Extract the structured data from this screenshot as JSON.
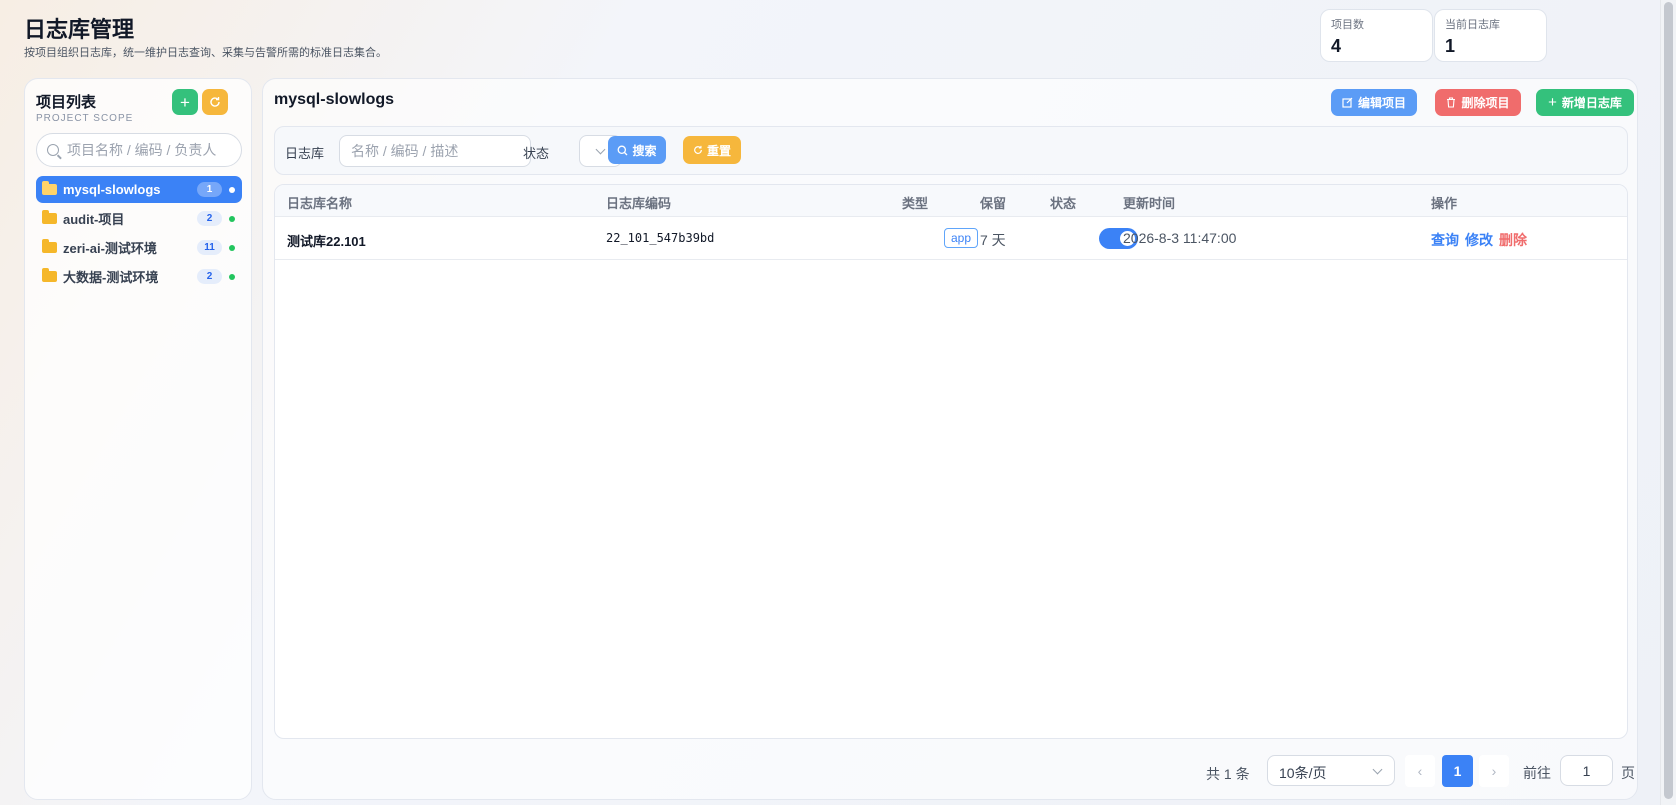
{
  "header": {
    "title": "日志库管理",
    "subtitle": "按项目组织日志库，统一维护日志查询、采集与告警所需的标准日志集合。",
    "stats": [
      {
        "label": "项目数",
        "value": "4"
      },
      {
        "label": "当前日志库",
        "value": "1"
      }
    ]
  },
  "sidebar": {
    "title": "项目列表",
    "subtitle": "PROJECT SCOPE",
    "add_icon": "plus-icon",
    "refresh_icon": "refresh-icon",
    "search_placeholder": "项目名称 / 编码 / 负责人",
    "projects": [
      {
        "name": "mysql-slowlogs",
        "count": "1",
        "active": true
      },
      {
        "name": "audit-项目",
        "count": "2",
        "active": false
      },
      {
        "name": "zeri-ai-测试环境",
        "count": "11",
        "active": false
      },
      {
        "name": "大数据-测试环境",
        "count": "2",
        "active": false
      }
    ]
  },
  "main": {
    "title": "mysql-slowlogs",
    "actions": {
      "edit": "编辑项目",
      "delete": "删除项目",
      "add": "新增日志库"
    },
    "filter": {
      "logstore_label": "日志库",
      "logstore_placeholder": "名称 / 编码 / 描述",
      "status_label": "状态",
      "search_button": "搜索",
      "reset_button": "重置"
    },
    "table": {
      "columns": [
        "日志库名称",
        "日志库编码",
        "类型",
        "保留",
        "状态",
        "更新时间",
        "操作"
      ],
      "rows": [
        {
          "name": "测试库22.101",
          "code": "22_101_547b39bd",
          "type": "app",
          "retention": "7 天",
          "status_on": true,
          "updated": "2026-8-3 11:47:00"
        }
      ],
      "row_actions": {
        "query": "查询",
        "edit": "修改",
        "delete": "删除"
      }
    },
    "pagination": {
      "total": "共 1 条",
      "page_size": "10条/页",
      "current_page": "1",
      "goto_label": "前往",
      "goto_value": "1",
      "page_suffix": "页"
    }
  },
  "colors": {
    "primary": "#3b82f6",
    "success": "#34c17c",
    "warning": "#f6b73c",
    "danger": "#f06c6c"
  }
}
